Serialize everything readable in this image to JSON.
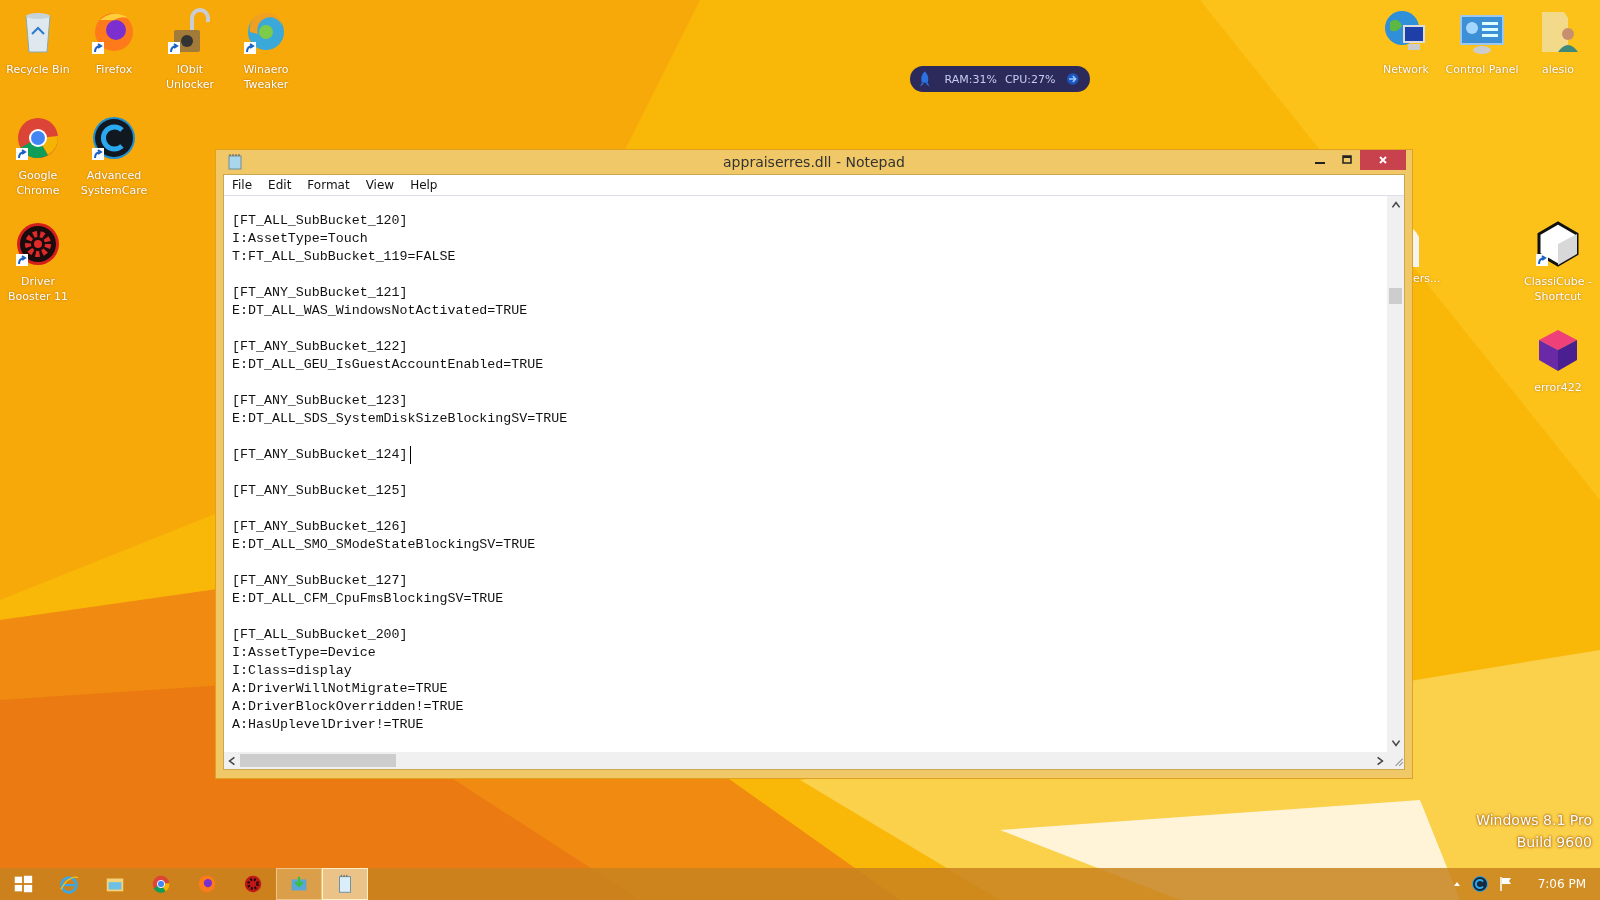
{
  "desktop_icons": [
    {
      "label": "Recycle Bin",
      "kind": "bin",
      "shortcut": false
    },
    {
      "label": "Firefox",
      "kind": "firefox",
      "shortcut": true
    },
    {
      "label": "IObit Unlocker",
      "kind": "lock",
      "shortcut": true
    },
    {
      "label": "Winaero Tweaker",
      "kind": "swirl",
      "shortcut": true
    },
    {
      "label": "Google Chrome",
      "kind": "chrome",
      "shortcut": true
    },
    {
      "label": "Advanced SystemCare",
      "kind": "care",
      "shortcut": true
    },
    {
      "label": "Driver Booster 11",
      "kind": "gear",
      "shortcut": true
    },
    {
      "label": "Network",
      "kind": "network",
      "shortcut": false
    },
    {
      "label": "Control Panel",
      "kind": "panel",
      "shortcut": false
    },
    {
      "label": "alesio",
      "kind": "userfolder",
      "shortcut": false
    },
    {
      "label": "ClassiCube - Shortcut",
      "kind": "cube",
      "shortcut": true
    },
    {
      "label": "error422",
      "kind": "noisecube",
      "shortcut": false
    }
  ],
  "hidden_icon": {
    "label": "ers..."
  },
  "monitor_widget": {
    "ram": "RAM:31%",
    "cpu": "CPU:27%"
  },
  "window": {
    "title": "appraiserres.dll - Notepad",
    "menu": [
      "File",
      "Edit",
      "Format",
      "View",
      "Help"
    ],
    "sections": [
      {
        "lines": [
          "[FT_ALL_SubBucket_120]",
          "I:AssetType=Touch",
          "T:FT_ALL_SubBucket_119=FALSE"
        ],
        "caret": false
      },
      {
        "lines": [
          "[FT_ANY_SubBucket_121]",
          "E:DT_ALL_WAS_WindowsNotActivated=TRUE"
        ],
        "caret": false
      },
      {
        "lines": [
          "[FT_ANY_SubBucket_122]",
          "E:DT_ALL_GEU_IsGuestAccountEnabled=TRUE"
        ],
        "caret": false
      },
      {
        "lines": [
          "[FT_ANY_SubBucket_123]",
          "E:DT_ALL_SDS_SystemDiskSizeBlockingSV=TRUE"
        ],
        "caret": false
      },
      {
        "lines": [
          "[FT_ANY_SubBucket_124]"
        ],
        "caret": true
      },
      {
        "lines": [
          "[FT_ANY_SubBucket_125]"
        ],
        "caret": false
      },
      {
        "lines": [
          "[FT_ANY_SubBucket_126]",
          "E:DT_ALL_SMO_SModeStateBlockingSV=TRUE"
        ],
        "caret": false
      },
      {
        "lines": [
          "[FT_ANY_SubBucket_127]",
          "E:DT_ALL_CFM_CpuFmsBlockingSV=TRUE"
        ],
        "caret": false
      },
      {
        "lines": [
          "[FT_ALL_SubBucket_200]",
          "I:AssetType=Device",
          "I:Class=display",
          "A:DriverWillNotMigrate=TRUE",
          "A:DriverBlockOverridden!=TRUE",
          "A:HasUplevelDriver!=TRUE"
        ],
        "caret": false
      }
    ]
  },
  "os_watermark": [
    "Windows 8.1 Pro",
    "Build 9600"
  ],
  "taskbar": {
    "items": [
      {
        "kind": "start",
        "running": false,
        "selected": false
      },
      {
        "kind": "ie",
        "running": false,
        "selected": false
      },
      {
        "kind": "explorer",
        "running": false,
        "selected": false
      },
      {
        "kind": "chrome",
        "running": false,
        "selected": false
      },
      {
        "kind": "firefox",
        "running": false,
        "selected": false
      },
      {
        "kind": "gear",
        "running": false,
        "selected": false
      },
      {
        "kind": "tool",
        "running": true,
        "selected": false
      },
      {
        "kind": "notepad",
        "running": true,
        "selected": true
      }
    ],
    "clock": "7:06 PM"
  }
}
